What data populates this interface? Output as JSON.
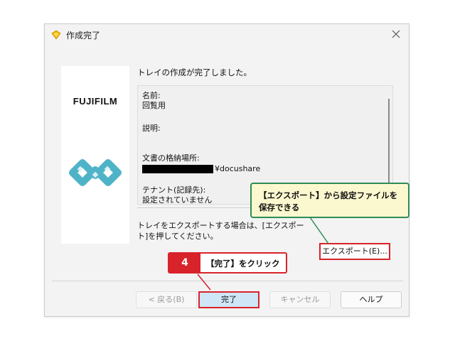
{
  "window": {
    "title": "作成完了",
    "icon": "tray-folder-icon",
    "close_icon": "close-icon"
  },
  "brand": {
    "logo_text": "FUJIFILM",
    "art_icon": "docushare-cubes-icon"
  },
  "main": {
    "message": "トレイの作成が完了しました。",
    "info": {
      "name_label": "名前:",
      "name_value": "回覧用",
      "description_label": "説明:",
      "location_label": "文書の格納場所:",
      "location_value": "¥docushare",
      "tenant_label": "テナント(記録先):",
      "tenant_value": "設定されていません"
    },
    "hint": "トレイをエクスポートする場合は、[エクスポート]を押してください。",
    "export_button": "エクスポート(E)..."
  },
  "footer": {
    "back_button": "< 戻る(B)",
    "finish_button": "完了",
    "cancel_button": "キャンセル",
    "help_button": "ヘルプ"
  },
  "annotations": {
    "callout_text": "【エクスポート】から設定ファイルを保存できる",
    "step_number": "4",
    "step_text": "【完了】をクリック",
    "colors": {
      "red": "#d8232a",
      "green": "#2e8b57",
      "yellow": "#fbf7cf"
    }
  }
}
